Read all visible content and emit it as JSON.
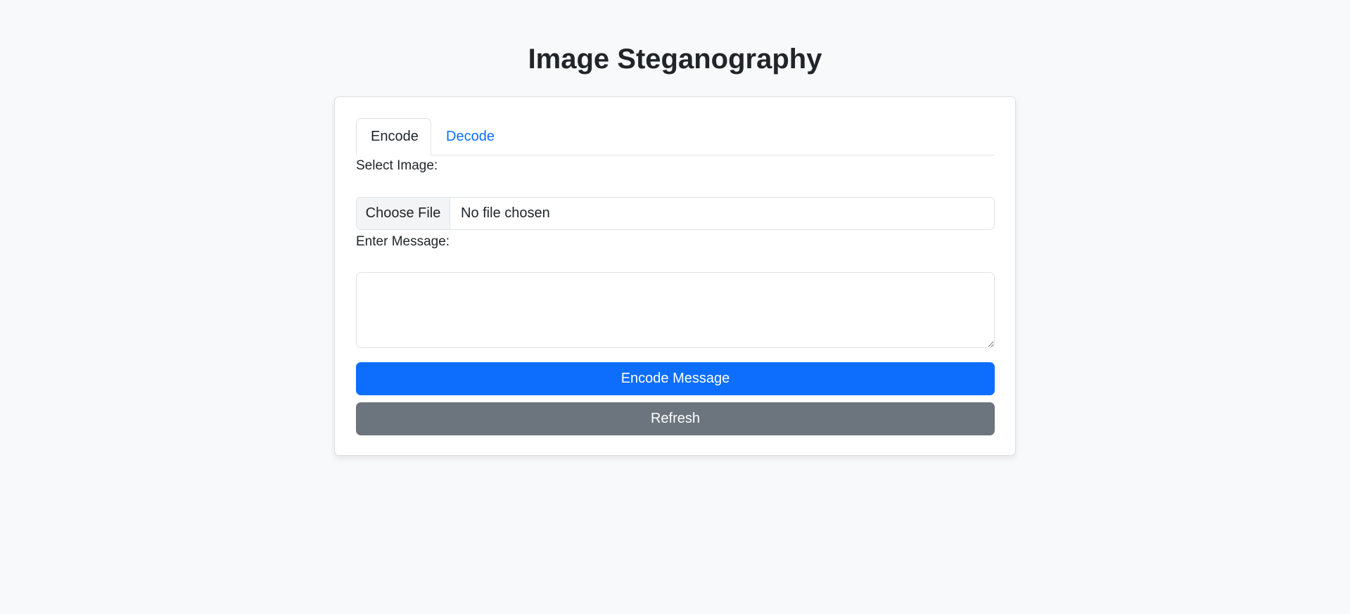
{
  "page": {
    "title": "Image Steganography"
  },
  "tabs": [
    {
      "label": "Encode",
      "active": true
    },
    {
      "label": "Decode",
      "active": false
    }
  ],
  "form": {
    "select_image_label": "Select Image:",
    "choose_file_label": "Choose File",
    "file_status": "No file chosen",
    "message_label": "Enter Message:",
    "message_value": "",
    "message_placeholder": ""
  },
  "buttons": {
    "encode_label": "Encode Message",
    "refresh_label": "Refresh"
  },
  "colors": {
    "background": "#f8f9fa",
    "primary": "#0d6efd",
    "secondary": "#6c757d",
    "link": "#0d6efd"
  }
}
